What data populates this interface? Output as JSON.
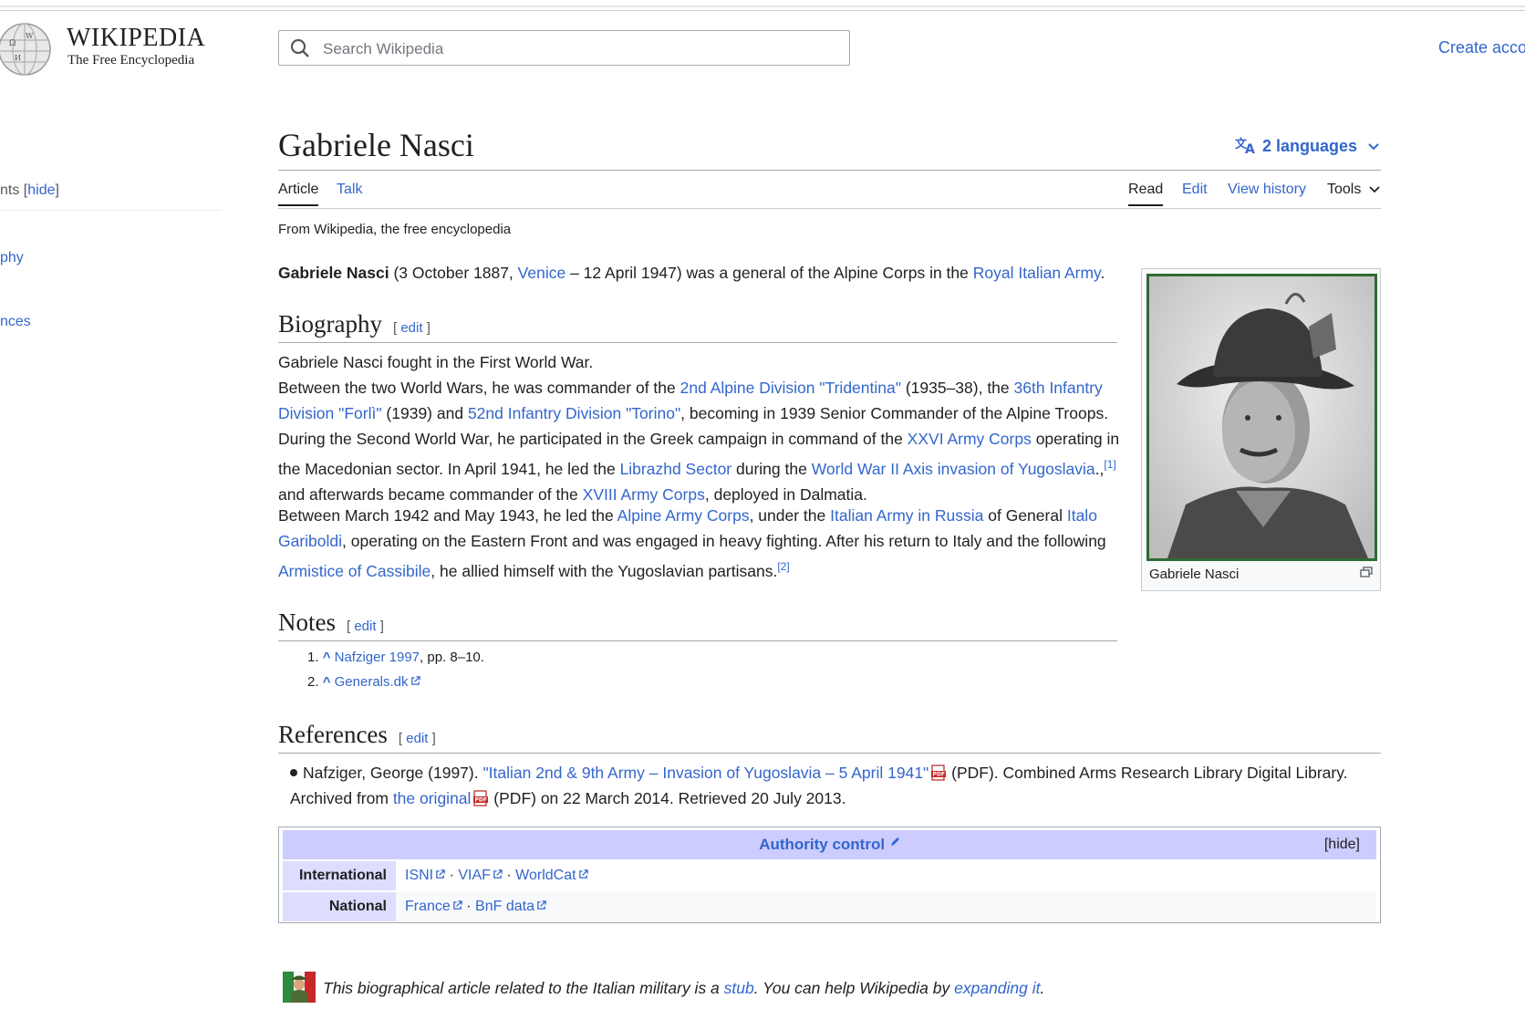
{
  "header": {
    "wordmark": "WIKIPEDIA",
    "tagline": "The Free Encyclopedia",
    "search_placeholder": "Search Wikipedia",
    "create_account": "Create acco"
  },
  "sidebar": {
    "toc_head": "nts",
    "toc_hide": "hide",
    "items": [
      "phy",
      "nces"
    ]
  },
  "article": {
    "title": "Gabriele Nasci",
    "languages": "2 languages",
    "tabs_left": [
      "Article",
      "Talk"
    ],
    "tabs_right": [
      "Read",
      "Edit",
      "View history",
      "Tools"
    ],
    "from": "From Wikipedia, the free encyclopedia",
    "lead": {
      "name": "Gabriele Nasci",
      "t1": " (3 October 1887, ",
      "venice": "Venice",
      "t2": " – 12 April 1947) was a general of the Alpine Corps in the ",
      "army": "Royal Italian Army",
      "t3": "."
    },
    "edit_label": "edit",
    "biography": {
      "heading": "Biography",
      "p1": "Gabriele Nasci fought in the First World War.",
      "p2": {
        "t1": "Between the two World Wars, he was commander of the ",
        "l1": "2nd Alpine Division \"Tridentina\"",
        "t2": " (1935–38), the ",
        "l2": "36th Infantry Division \"Forlì\"",
        "t3": " (1939) and ",
        "l3": "52nd Infantry Division \"Torino\"",
        "t4": ", becoming in 1939 Senior Commander of the Alpine Troops."
      },
      "p3": {
        "t1": "During the Second World War, he participated in the Greek campaign in command of the ",
        "l1": "XXVI Army Corps",
        "t2": " operating in the Macedonian sector. In April 1941, he led the ",
        "l2": "Librazhd Sector",
        "t3": " during the ",
        "l3": "World War II Axis invasion of Yugoslavia",
        "t4": ".,",
        "sup": "[1]",
        "t5": " and afterwards became commander of the ",
        "l4": "XVIII Army Corps",
        "t6": ", deployed in Dalmatia."
      },
      "p4": {
        "t1": "Between March 1942 and May 1943, he led the ",
        "l1": "Alpine Army Corps",
        "t2": ", under the ",
        "l2": "Italian Army in Russia",
        "t3": " of General ",
        "l3": "Italo Gariboldi",
        "t4": ", operating on the Eastern Front and was engaged in heavy fighting. After his return to Italy and the following ",
        "l4": "Armistice of Cassibile",
        "t5": ", he allied himself with the Yugoslavian partisans.",
        "sup": "[2]"
      }
    },
    "infobox": {
      "caption": "Gabriele Nasci"
    },
    "notes": {
      "heading": "Notes",
      "items": [
        {
          "num": "1.",
          "caret": "^",
          "link": "Nafziger 1997",
          "tail": ", pp. 8–10."
        },
        {
          "num": "2.",
          "caret": "^",
          "link": "Generals.dk",
          "tail": ""
        }
      ]
    },
    "references": {
      "heading": "References",
      "t1": "Nafziger, George (1997). ",
      "l1": "\"Italian 2nd & 9th Army – Invasion of Yugoslavia – 5 April 1941\"",
      "t2": " (PDF). Combined Arms Research Library Digital Library. Archived from ",
      "l2": "the original",
      "t3": " (PDF) on 22 March 2014. Retrieved 20 July 2013."
    },
    "authority": {
      "title": "Authority control",
      "hide": "[hide]",
      "rows": [
        {
          "label": "International",
          "links": [
            "ISNI",
            "VIAF",
            "WorldCat"
          ]
        },
        {
          "label": "National",
          "links": [
            "France",
            "BnF data"
          ]
        }
      ]
    },
    "stub": {
      "t1": "This biographical article related to the Italian military is a ",
      "l1": "stub",
      "t2": ". You can help Wikipedia by ",
      "l2": "expanding it",
      "t3": "."
    }
  },
  "colors": {
    "link": "#3366cc",
    "ac_head": "#ccccff",
    "ac_label": "#ddddff"
  }
}
